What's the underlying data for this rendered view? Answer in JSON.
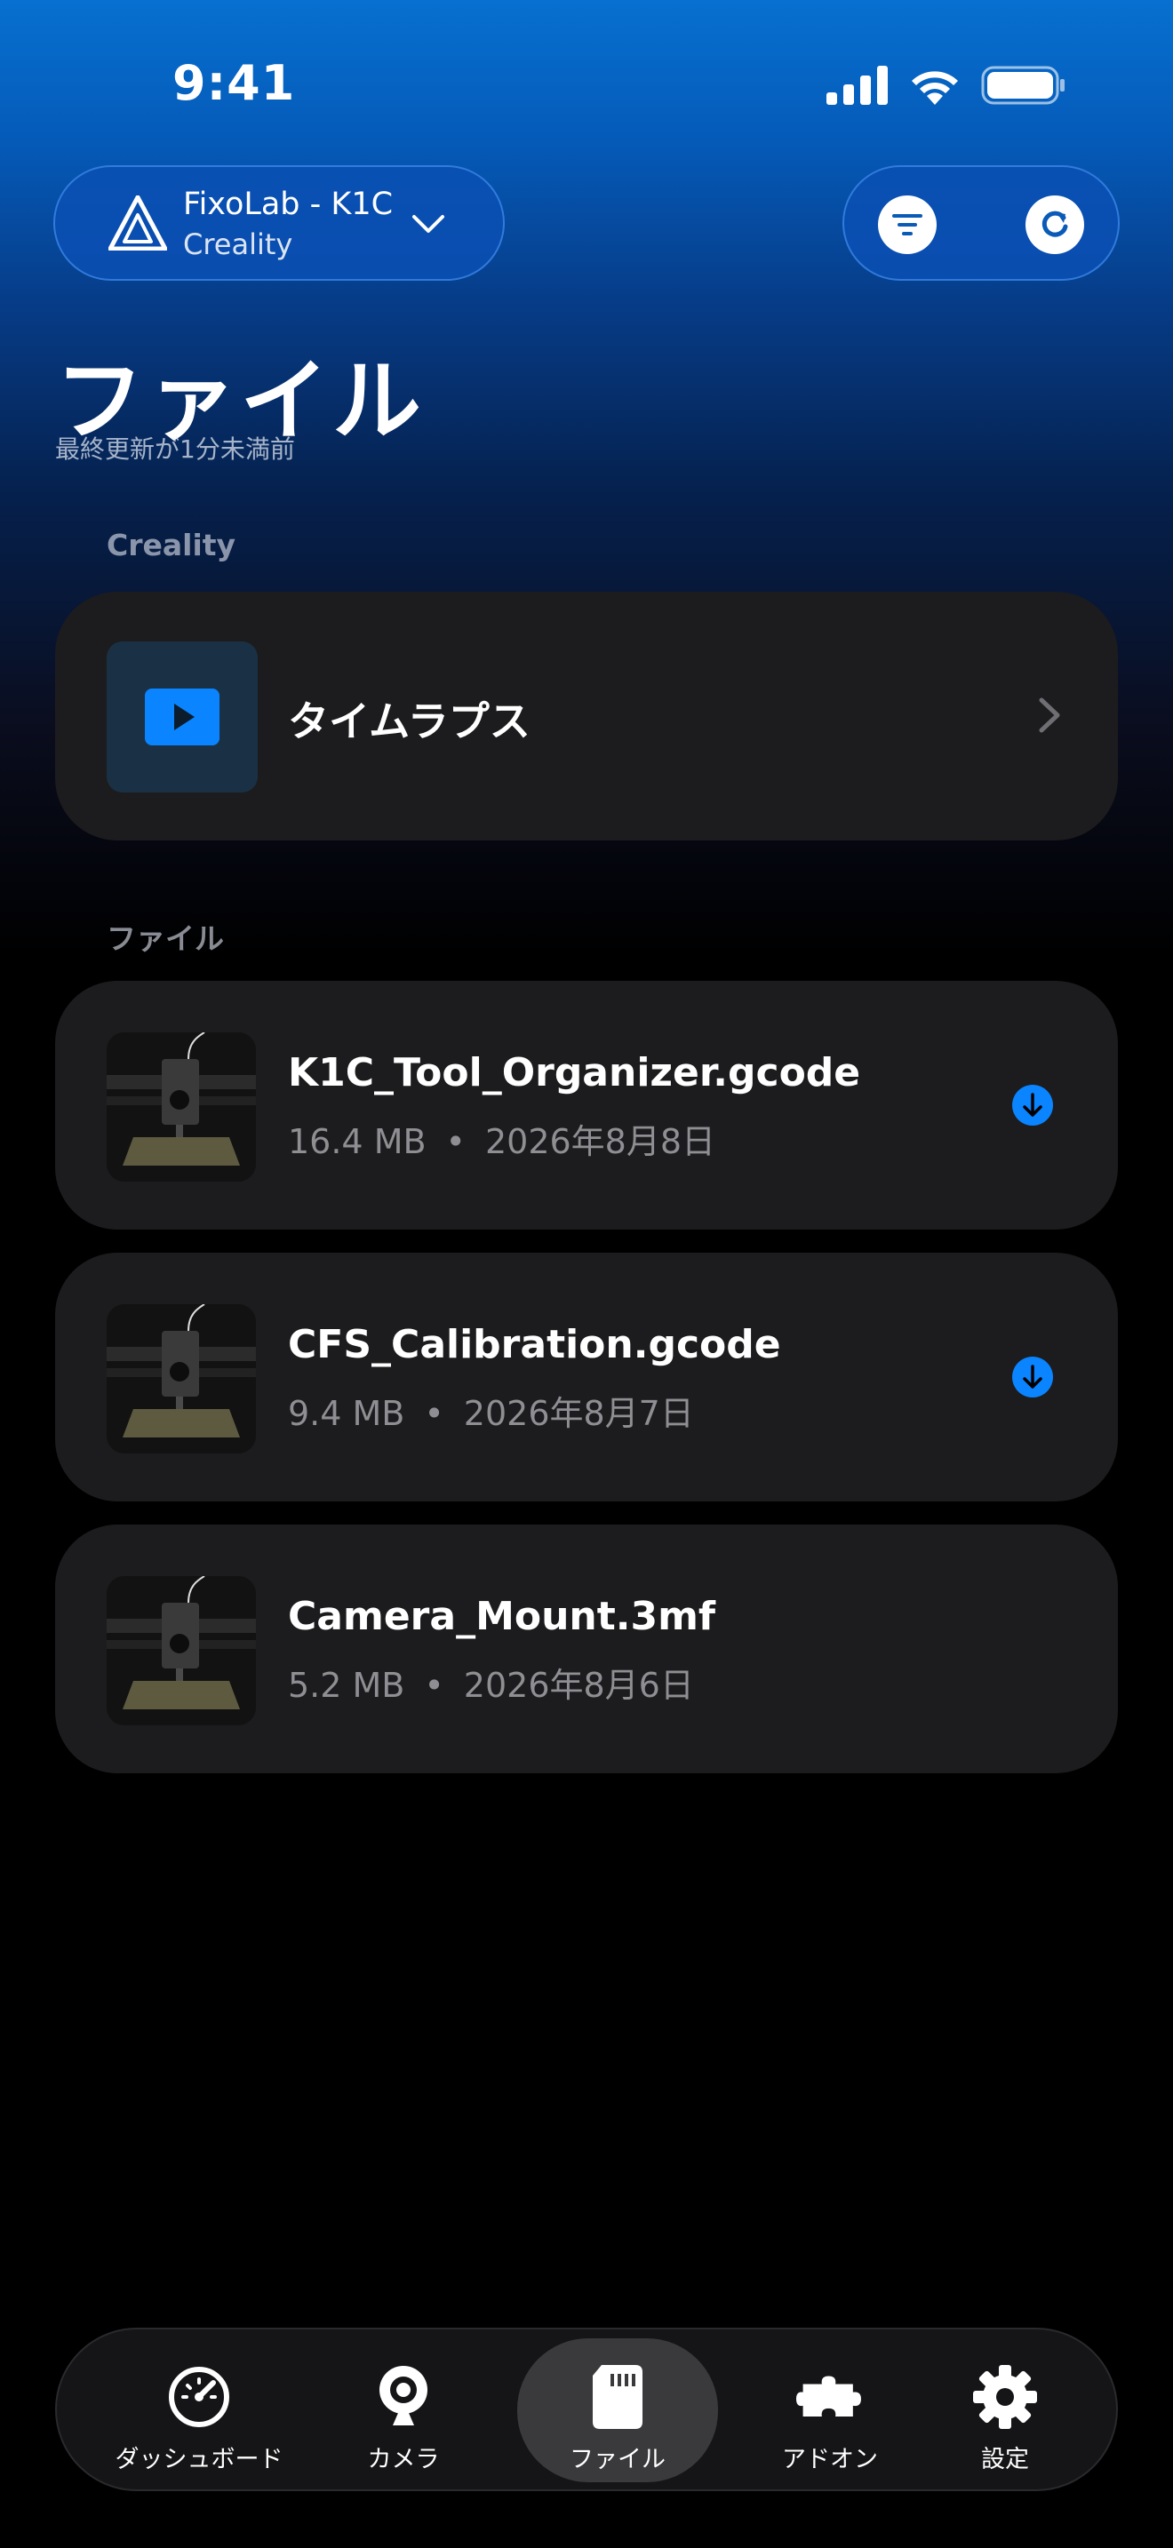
{
  "status_bar": {
    "time": "9:41"
  },
  "printer": {
    "name": "FixoLab - K1C",
    "brand": "Creality"
  },
  "header": {
    "title": "ファイル",
    "subtitle": "最終更新が1分未満前"
  },
  "sections": {
    "creality_label": "Creality",
    "files_label": "ファイル"
  },
  "timelapse": {
    "label": "タイムラプス"
  },
  "files": [
    {
      "name": "K1C_Tool_Organizer.gcode",
      "size": "16.4 MB",
      "date": "2026年8月8日",
      "download": true
    },
    {
      "name": "CFS_Calibration.gcode",
      "size": "9.4 MB",
      "date": "2026年8月7日",
      "download": true
    },
    {
      "name": "Camera_Mount.3mf",
      "size": "5.2 MB",
      "date": "2026年8月6日",
      "download": false
    }
  ],
  "meta_separator": "•",
  "tabs": [
    {
      "label": "ダッシュボード",
      "icon": "gauge-icon"
    },
    {
      "label": "カメラ",
      "icon": "webcam-icon"
    },
    {
      "label": "ファイル",
      "icon": "sd-card-icon",
      "active": true
    },
    {
      "label": "アドオン",
      "icon": "puzzle-icon"
    },
    {
      "label": "設定",
      "icon": "gear-icon"
    }
  ],
  "colors": {
    "accent": "#0a84ff",
    "card": "#1c1c1e",
    "meta": "#8e8e93"
  }
}
